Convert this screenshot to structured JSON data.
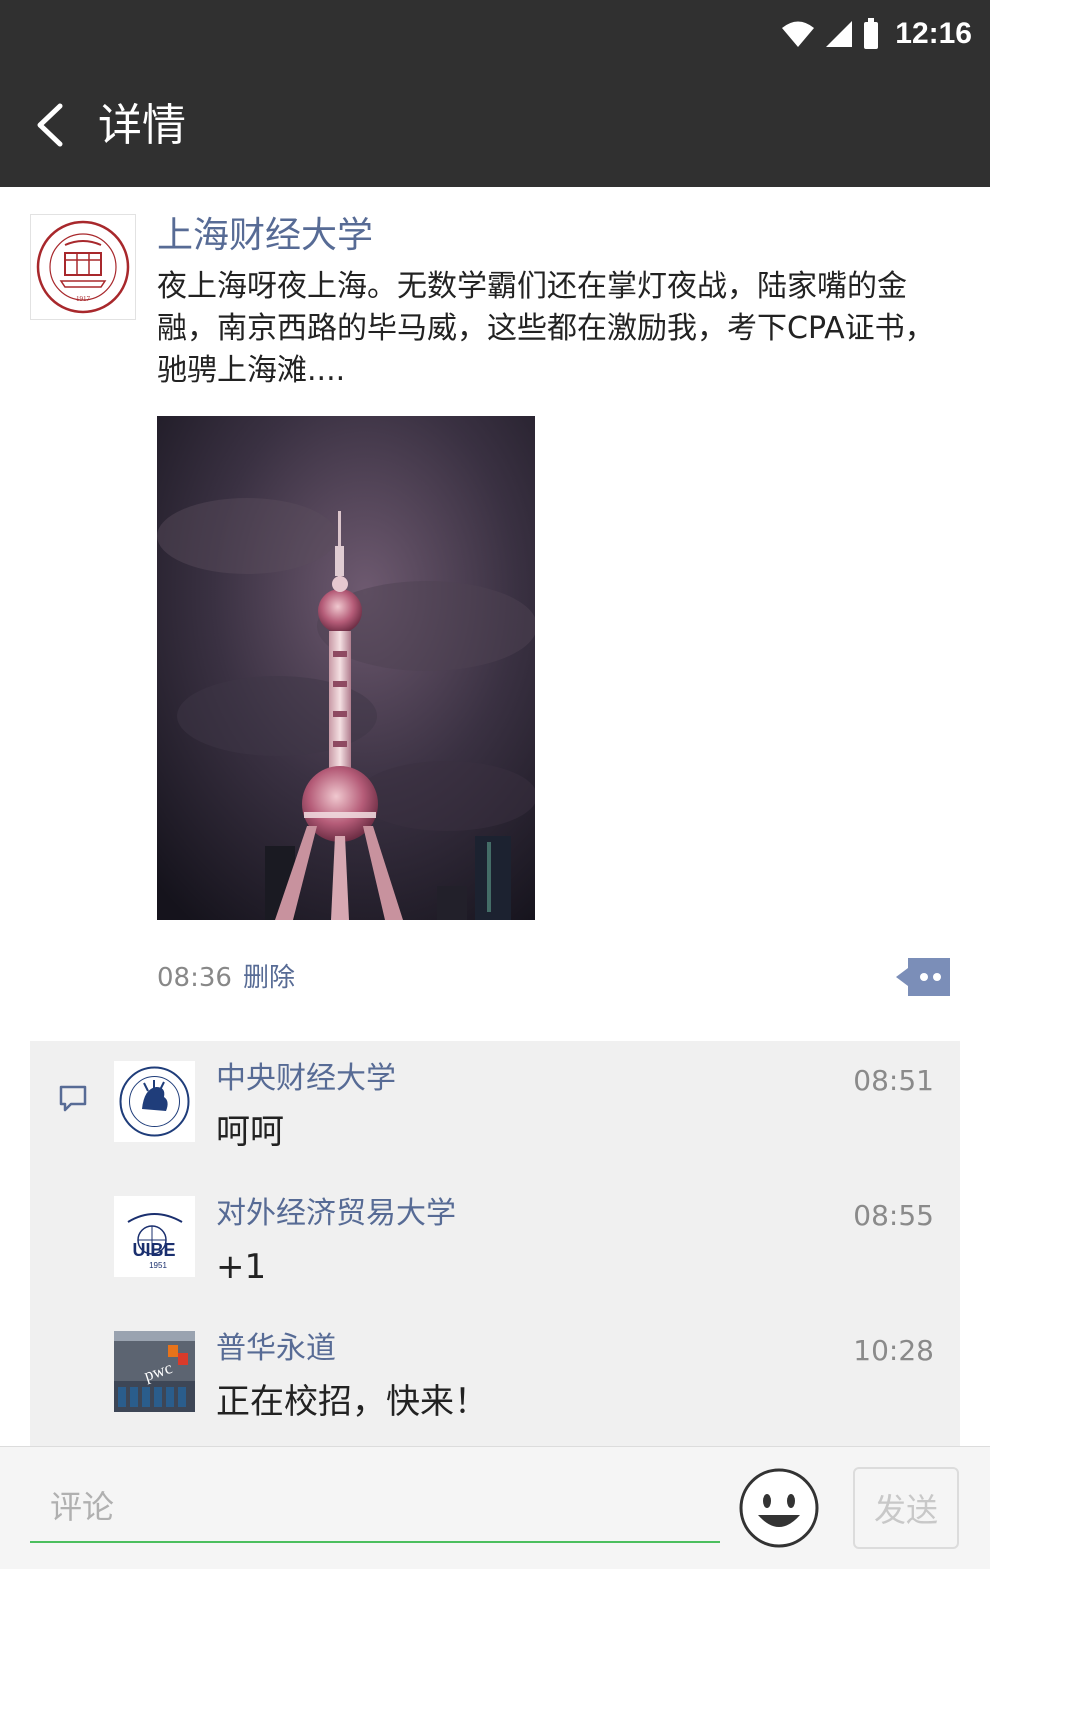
{
  "status": {
    "time": "12:16"
  },
  "header": {
    "title": "详情"
  },
  "post": {
    "author": "上海财经大学",
    "text": "夜上海呀夜上海。无数学霸们还在掌灯夜战，陆家嘴的金融，南京西路的毕马威，这些都在激励我，考下CPA证书，驰骋上海滩....",
    "time": "08:36",
    "delete_label": "删除",
    "avatar_logo_text": [
      "SHANGHAI UNIVERSITY OF FINANCE & ECONOMICS",
      "上海财经大学",
      "1917"
    ]
  },
  "comments": [
    {
      "name": "中央财经大学",
      "time": "08:51",
      "text": "呵呵"
    },
    {
      "name": "对外经济贸易大学",
      "time": "08:55",
      "text": "+1",
      "logo_text": [
        "UIBE",
        "1951"
      ]
    },
    {
      "name": "普华永道",
      "time": "10:28",
      "text": "正在校招，快来！",
      "logo_text": "pwc"
    }
  ],
  "input_bar": {
    "placeholder": "评论",
    "send_label": "发送"
  },
  "colors": {
    "header_bg": "#303030",
    "link": "#576b95",
    "input_underline": "#4cbf5e",
    "panel_bg": "#f0f0f0"
  },
  "icons": [
    "wifi-icon",
    "signal-icon",
    "battery-icon",
    "back-arrow-icon",
    "more-actions-icon",
    "comment-icon",
    "emoji-icon"
  ]
}
